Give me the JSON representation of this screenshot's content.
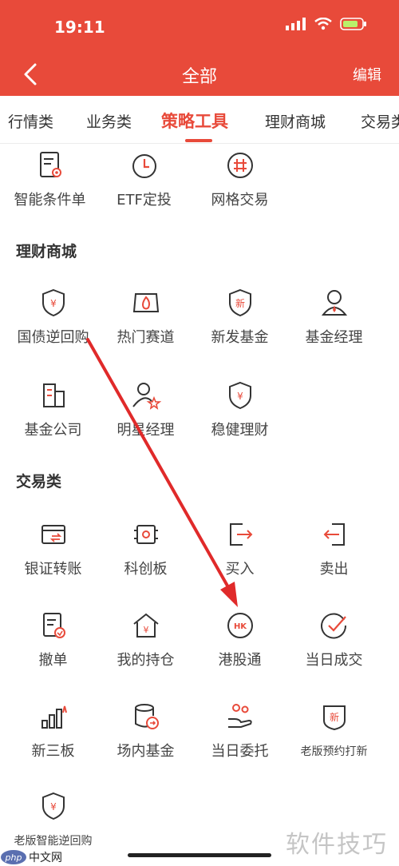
{
  "status": {
    "time": "19:11"
  },
  "nav": {
    "title": "全部",
    "edit": "编辑"
  },
  "tabs": [
    "行情类",
    "业务类",
    "策略工具",
    "理财商城",
    "交易类"
  ],
  "sections": {
    "strategy_items": [
      {
        "label": "智能条件单",
        "icon": "conditional-order-icon"
      },
      {
        "label": "ETF定投",
        "icon": "timer-icon"
      },
      {
        "label": "网格交易",
        "icon": "grid-icon"
      }
    ],
    "wealth": {
      "title": "理财商城",
      "items": [
        {
          "label": "国债逆回购",
          "icon": "shield-yuan-icon"
        },
        {
          "label": "热门赛道",
          "icon": "hot-track-icon"
        },
        {
          "label": "新发基金",
          "icon": "new-fund-icon"
        },
        {
          "label": "基金经理",
          "icon": "manager-icon"
        },
        {
          "label": "基金公司",
          "icon": "company-icon"
        },
        {
          "label": "明星经理",
          "icon": "star-manager-icon"
        },
        {
          "label": "稳健理财",
          "icon": "shield-yuan-icon"
        }
      ]
    },
    "trade": {
      "title": "交易类",
      "items": [
        {
          "label": "银证转账",
          "icon": "transfer-icon"
        },
        {
          "label": "科创板",
          "icon": "chip-icon"
        },
        {
          "label": "买入",
          "icon": "buy-icon"
        },
        {
          "label": "卖出",
          "icon": "sell-icon"
        },
        {
          "label": "撤单",
          "icon": "cancel-order-icon"
        },
        {
          "label": "我的持仓",
          "icon": "holdings-icon"
        },
        {
          "label": "港股通",
          "icon": "hk-icon"
        },
        {
          "label": "当日成交",
          "icon": "deal-check-icon"
        },
        {
          "label": "新三板",
          "icon": "bar-chart-icon"
        },
        {
          "label": "场内基金",
          "icon": "exchange-fund-icon"
        },
        {
          "label": "当日委托",
          "icon": "entrust-icon"
        },
        {
          "label": "老版预约打新",
          "icon": "new-badge-icon"
        },
        {
          "label": "老版智能逆回购",
          "icon": "shield-yuan-icon"
        }
      ]
    }
  },
  "watermarks": {
    "left": "php中文网",
    "right": "软件技巧"
  },
  "colors": {
    "brand": "#e84a3a",
    "icon": "#333333"
  }
}
